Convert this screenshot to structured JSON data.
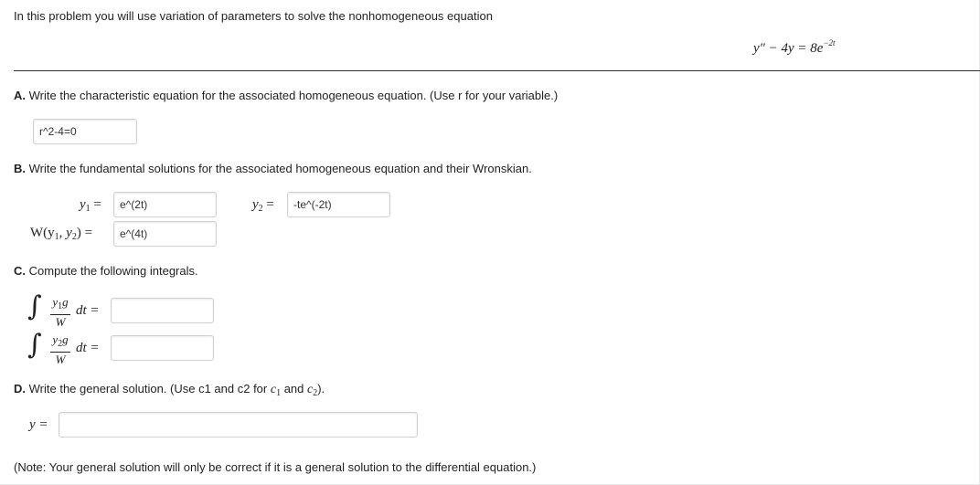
{
  "intro": "In this problem you will use variation of parameters to solve the nonhomogeneous equation",
  "equation": {
    "lhs": "y″ − 4y = 8e",
    "exponent": "−2t"
  },
  "partA": {
    "letter": "A.",
    "text": "Write the characteristic equation for the associated homogeneous equation. (Use r for your variable.)",
    "answer": "r^2-4=0"
  },
  "partB": {
    "letter": "B.",
    "text": "Write the fundamental solutions for the associated homogeneous equation and their Wronskian.",
    "y1_label": "y",
    "y1_sub": "1",
    "y1_value": "e^(2t)",
    "y2_label": "y",
    "y2_sub": "2",
    "y2_value": "-te^(-2t)",
    "w_label": "W",
    "w_args": "(y",
    "w_sub1": "1",
    "w_mid": ", y",
    "w_sub2": "2",
    "w_close": ")",
    "w_value": "e^(4t)",
    "equals": "="
  },
  "partC": {
    "letter": "C.",
    "text": "Compute the following integrals.",
    "integral1": {
      "num_var": "y",
      "num_sub": "1",
      "num_g": "g",
      "den": "W",
      "dt": "dt =",
      "value": ""
    },
    "integral2": {
      "num_var": "y",
      "num_sub": "2",
      "num_g": "g",
      "den": "W",
      "dt": "dt =",
      "value": ""
    },
    "integral_sign": "∫"
  },
  "partD": {
    "letter": "D.",
    "text_before": "Write the general solution. (Use c1 and c2 for ",
    "c1": "c",
    "c1_sub": "1",
    "and": " and ",
    "c2": "c",
    "c2_sub": "2",
    "text_after": ").",
    "y_label": "y =",
    "value": ""
  },
  "note": "(Note: Your general solution will only be correct if it is a general solution to the differential equation.)"
}
